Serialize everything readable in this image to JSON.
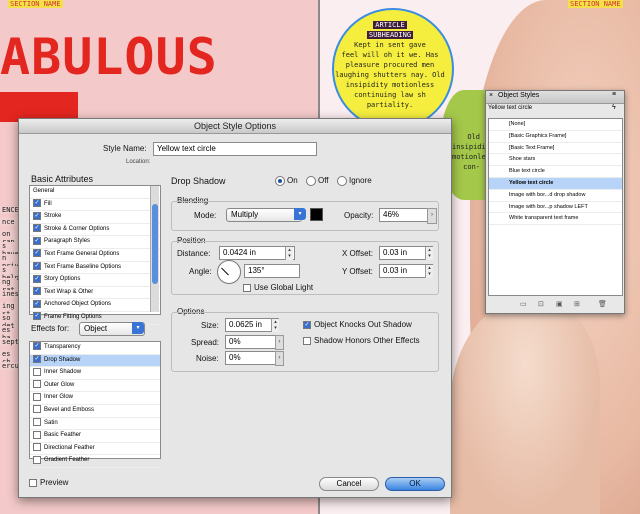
{
  "background": {
    "section_name_left": "SECTION NAME",
    "section_name_right": "SECTION NAME",
    "headline": "ABULOUS",
    "article_heading": "ARTICLE",
    "article_subheading": "SUBHEADING",
    "article_lines": [
      "Kept in sent gave",
      "feel will oh it we. Has",
      "pleasure procured men",
      "laughing shutters nay. Old",
      "insipidity motionless",
      "continuing law sh",
      "partiality."
    ],
    "green_snips": [
      "Old",
      "insipidity",
      "motionless",
      "con-"
    ],
    "left_list": [
      "ENCE",
      "nce",
      "on rap",
      "s have",
      "n priv",
      "s help",
      "ng rat",
      "iness",
      "ing st",
      "so det",
      "es ha",
      "septe",
      "es ch",
      "ercul"
    ]
  },
  "dialog": {
    "title": "Object Style Options",
    "style_name_label": "Style Name:",
    "style_name_value": "Yellow text circle",
    "location_label": "Location:",
    "basic_attributes_label": "Basic Attributes",
    "basic_attributes": [
      {
        "label": "General",
        "checkbox": false
      },
      {
        "label": "Fill",
        "checkbox": true
      },
      {
        "label": "Stroke",
        "checkbox": true
      },
      {
        "label": "Stroke & Corner Options",
        "checkbox": true
      },
      {
        "label": "Paragraph Styles",
        "checkbox": true
      },
      {
        "label": "Text Frame General Options",
        "checkbox": true
      },
      {
        "label": "Text Frame Baseline Options",
        "checkbox": true
      },
      {
        "label": "Story Options",
        "checkbox": true
      },
      {
        "label": "Text Wrap & Other",
        "checkbox": true
      },
      {
        "label": "Anchored Object Options",
        "checkbox": true
      },
      {
        "label": "Frame Fitting Options",
        "checkbox": true
      }
    ],
    "effects_for_label": "Effects for:",
    "effects_for_value": "Object",
    "effects": [
      {
        "label": "Transparency",
        "checked": true,
        "selected": false
      },
      {
        "label": "Drop Shadow",
        "checked": true,
        "selected": true
      },
      {
        "label": "Inner Shadow",
        "checked": false,
        "selected": false
      },
      {
        "label": "Outer Glow",
        "checked": false,
        "selected": false
      },
      {
        "label": "Inner Glow",
        "checked": false,
        "selected": false
      },
      {
        "label": "Bevel and Emboss",
        "checked": false,
        "selected": false
      },
      {
        "label": "Satin",
        "checked": false,
        "selected": false
      },
      {
        "label": "Basic Feather",
        "checked": false,
        "selected": false
      },
      {
        "label": "Directional Feather",
        "checked": false,
        "selected": false
      },
      {
        "label": "Gradient Feather",
        "checked": false,
        "selected": false
      }
    ],
    "preview_label": "Preview",
    "drop_shadow_label": "Drop Shadow",
    "on_label": "On",
    "off_label": "Off",
    "ignore_label": "Ignore",
    "blending": {
      "group_label": "Blending",
      "mode_label": "Mode:",
      "mode_value": "Multiply",
      "opacity_label": "Opacity:",
      "opacity_value": "46%"
    },
    "position": {
      "group_label": "Position",
      "distance_label": "Distance:",
      "distance_value": "0.0424 in",
      "angle_label": "Angle:",
      "angle_value": "135°",
      "global_light_label": "Use Global Light",
      "x_offset_label": "X Offset:",
      "x_offset_value": "0.03 in",
      "y_offset_label": "Y Offset:",
      "y_offset_value": "0.03 in"
    },
    "options": {
      "group_label": "Options",
      "size_label": "Size:",
      "size_value": "0.0625 in",
      "spread_label": "Spread:",
      "spread_value": "0%",
      "noise_label": "Noise:",
      "noise_value": "0%",
      "knocks_out_label": "Object Knocks Out Shadow",
      "honors_label": "Shadow Honors Other Effects"
    },
    "cancel_label": "Cancel",
    "ok_label": "OK"
  },
  "panel": {
    "title": "Object Styles",
    "current": "Yellow text circle",
    "items": [
      {
        "label": "[None]",
        "selected": false
      },
      {
        "label": "[Basic Graphics Frame]",
        "selected": false
      },
      {
        "label": "[Basic Text Frame]",
        "selected": false
      },
      {
        "label": "Shoe stars",
        "selected": false
      },
      {
        "label": "Blue text circle",
        "selected": false
      },
      {
        "label": "Yellow text circle",
        "selected": true
      },
      {
        "label": "Image with bor...d drop shadow",
        "selected": false
      },
      {
        "label": "Image with bor...p shadow LEFT",
        "selected": false
      },
      {
        "label": "White transparent text frame",
        "selected": false
      }
    ]
  }
}
